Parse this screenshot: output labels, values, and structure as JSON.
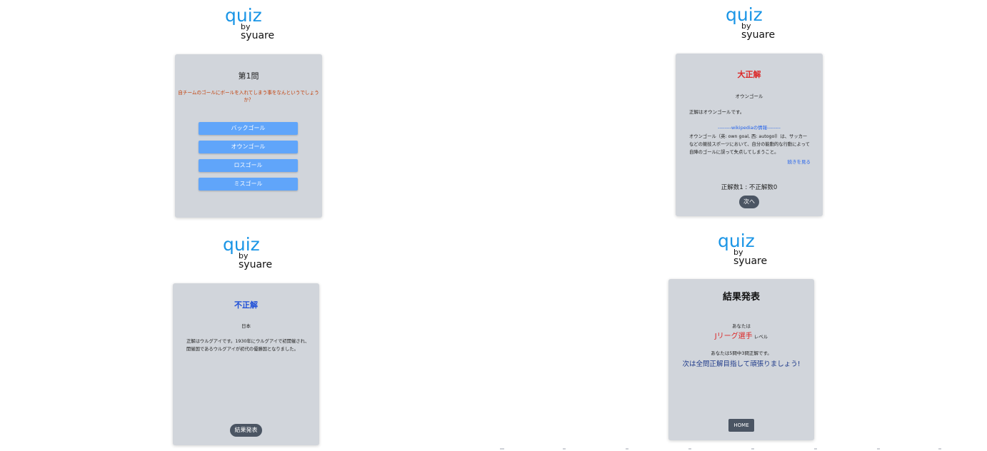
{
  "logo": {
    "quiz": "quiz",
    "by": "by",
    "author": "syuare"
  },
  "question_screen": {
    "number": "第1問",
    "question": "自チームのゴールにボールを入れてしまう事をなんというでしょうか？",
    "options": [
      "バックゴール",
      "オウンゴール",
      "ロスゴール",
      "ミスゴール"
    ]
  },
  "correct_screen": {
    "verdict": "大正解",
    "answer": "オウンゴール",
    "explanation": "正解はオウンゴールです。",
    "wiki_header": "--------wikipediaの情報--------",
    "wiki_line1": "オウンゴール（英: own goal, 西: autogol）は、サッカー",
    "wiki_line2": "などの競技スポーツにおいて、自分の能動的な行動によって",
    "wiki_line3": "自陣のゴールに誤って失点してしまうこと。",
    "read_more": "続きを見る",
    "score": "正解数1 : 不正解数0",
    "next_button": "次へ"
  },
  "incorrect_screen": {
    "verdict": "不正解",
    "answer": "日本",
    "explanation_line1": "正解はウルグアイです。1930年にウルグアイで初開催され、",
    "explanation_line2": "開催国であるウルグアイが初代の優勝国となりました。",
    "results_button": "結果発表"
  },
  "result_screen": {
    "title": "結果発表",
    "you_are": "あなたは",
    "level_name": "Jリーグ選手",
    "level_suffix": "レベル",
    "summary": "あなたは5問中3問正解です。",
    "encouragement": "次は全問正解目指して頑張りましょう!",
    "home_button": "HOME"
  },
  "colors": {
    "quiz_blue": "#1a95e6",
    "card_bg": "#d1d5db",
    "button_blue": "#60a5fa",
    "correct_red": "#dc2626",
    "incorrect_blue": "#1d4ed8",
    "dark_button": "#4b5563"
  }
}
